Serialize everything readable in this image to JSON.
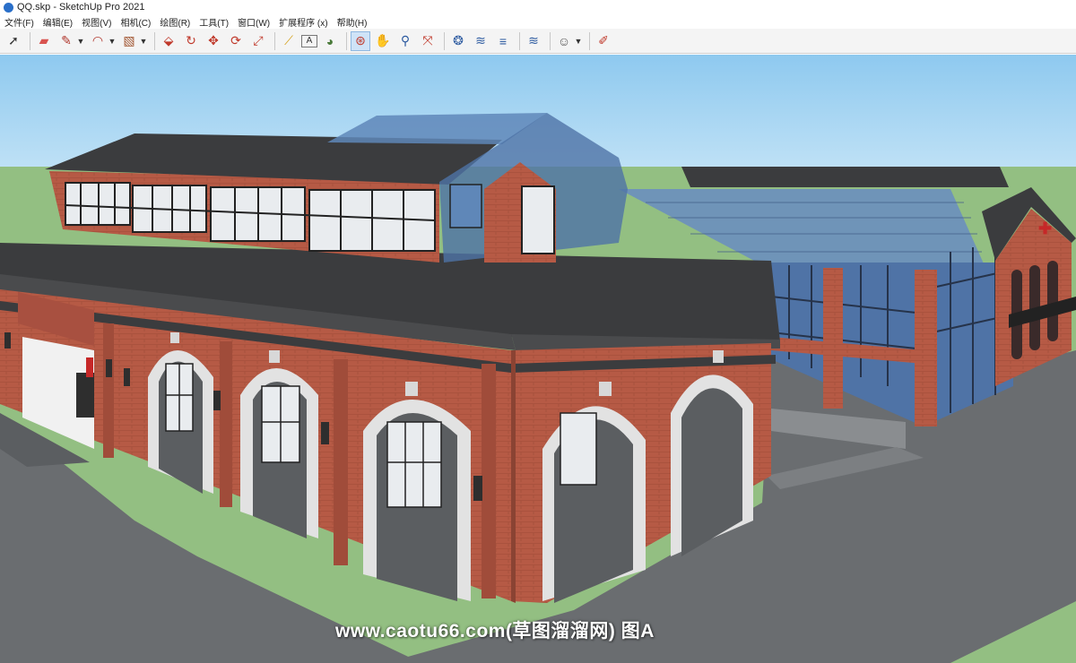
{
  "window": {
    "title": "QQ.skp - SketchUp Pro 2021"
  },
  "menu": [
    "文件(F)",
    "编辑(E)",
    "视图(V)",
    "相机(C)",
    "绘图(R)",
    "工具(T)",
    "窗口(W)",
    "扩展程序 (x)",
    "帮助(H)"
  ],
  "toolbar": {
    "tools": [
      {
        "name": "select-tool",
        "glyph": "➚"
      },
      {
        "name": "eraser-tool",
        "glyph": "▰"
      },
      {
        "name": "pencil-tool",
        "glyph": "✎"
      },
      {
        "name": "arc-tool",
        "glyph": "◠"
      },
      {
        "name": "shape-tool",
        "glyph": "▧"
      },
      {
        "name": "push-pull-tool",
        "glyph": "⬙"
      },
      {
        "name": "follow-me-tool",
        "glyph": "↻"
      },
      {
        "name": "move-tool",
        "glyph": "✥"
      },
      {
        "name": "rotate-tool",
        "glyph": "⟳"
      },
      {
        "name": "scale-tool",
        "glyph": "⤢"
      },
      {
        "name": "tape-measure-tool",
        "glyph": "⟋"
      },
      {
        "name": "text-tool",
        "glyph": "A"
      },
      {
        "name": "paint-bucket-tool",
        "glyph": "◕"
      },
      {
        "name": "orbit-tool",
        "glyph": "⊛"
      },
      {
        "name": "pan-tool",
        "glyph": "✋"
      },
      {
        "name": "zoom-tool",
        "glyph": "⚲"
      },
      {
        "name": "zoom-extents-tool",
        "glyph": "⤧"
      },
      {
        "name": "warehouse-tool",
        "glyph": "❂"
      },
      {
        "name": "extension-warehouse-tool",
        "glyph": "≋"
      },
      {
        "name": "layers-tool",
        "glyph": "≡"
      },
      {
        "name": "trimble-connect-tool",
        "glyph": "≋"
      },
      {
        "name": "profile-tool",
        "glyph": "☺"
      },
      {
        "name": "layout-tool",
        "glyph": "✐"
      }
    ]
  },
  "watermark": {
    "text": "www.caotu66.com(草图溜溜网) 图A"
  },
  "colors": {
    "sky": "#a9d7f4",
    "grass": "#93bf82",
    "road": "#6a6d70",
    "brick": "#b65a45",
    "roof": "#3b3c3e",
    "glass": "#5f87b8",
    "arch_trim": "#e2e2e2"
  }
}
